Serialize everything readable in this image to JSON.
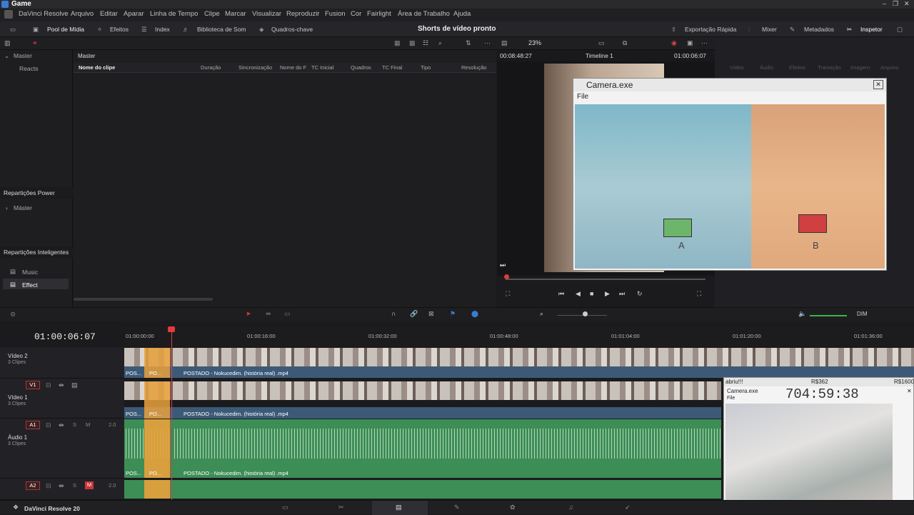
{
  "window": {
    "title": "Game"
  },
  "menu": [
    "DaVinci Resolve",
    "Arquivo",
    "Editar",
    "Aparar",
    "Linha de Tempo",
    "Clipe",
    "Marcar",
    "Visualizar",
    "Reproduzir",
    "Fusion",
    "Cor",
    "Fairlight",
    "Área de Trabalho",
    "Ajuda"
  ],
  "toolbar": {
    "media_pool": "Pool de Mídia",
    "effects": "Efeitos",
    "index": "Index",
    "sound_library": "Biblioteca de Som",
    "keyframes": "Quadros-chave",
    "project_title": "Shorts de vídeo pronto",
    "quick_export": "Exportação Rápida",
    "mixer": "Mixer",
    "metadata": "Metadados",
    "inspector": "Inspetor"
  },
  "viewer_bar": {
    "zoom": "23%",
    "timecode_left": "00:08:48:27",
    "timeline_name": "Timeline 1",
    "timecode_right": "01:00:06:07"
  },
  "left_panel": {
    "master": "Master",
    "reacts": "Reacts",
    "power_bins": "Repartições Power",
    "power_master": "Máster",
    "smart_bins": "Repartições Inteligentes",
    "music": "Music",
    "effect": "Effect"
  },
  "bin": {
    "header": "Master",
    "columns": [
      "Nome do clipe",
      "Duração",
      "Sincronização",
      "Nome do F",
      "TC Inicial",
      "Quadros",
      "TC Final",
      "Tipo",
      "Resolução"
    ]
  },
  "inspector_tabs": [
    "Vídeo",
    "Áudio",
    "Efeitos",
    "Transição",
    "Imagem",
    "Arquivo"
  ],
  "camera_window": {
    "title": "Camera.exe",
    "menu": "File",
    "label_a": "A",
    "label_b": "B"
  },
  "timeline": {
    "timecode": "01:00:06:07",
    "ruler": [
      "01:00:00:00",
      "01:00:16:00",
      "01:00:32:00",
      "01:00:48:00",
      "01:01:04:00",
      "01:01:20:00",
      "01:01:36:00"
    ],
    "dim": "DIM",
    "tracks": [
      {
        "name": "Vídeo 2",
        "clips": "3 Clipes",
        "clip_label": "POSTADO - Nokucedim. (história real) .mp4",
        "short1": "POS...",
        "short2": "PO..."
      },
      {
        "id": "V1",
        "name": "Vídeo 1",
        "clips": "3 Clipes",
        "clip_label": "POSTADO - Nokucedim. (história real) .mp4",
        "short1": "POS...",
        "short2": "PO..."
      },
      {
        "id": "A1",
        "name": "Áudio 1",
        "clips": "3 Clipes",
        "level": "2.0",
        "clip_label": "POSTADO - Nokucedim. (história real) .mp4",
        "short1": "POS...",
        "short2": "PO..."
      },
      {
        "id": "A2",
        "level": "2.0"
      }
    ]
  },
  "overlay": {
    "status": "abriu!!!",
    "price1": "R$362",
    "price2": "R$1600",
    "title": "Camera.exe",
    "menu": "File",
    "timer": "704:59:38"
  },
  "status": {
    "app": "DaVinci Resolve 20"
  }
}
